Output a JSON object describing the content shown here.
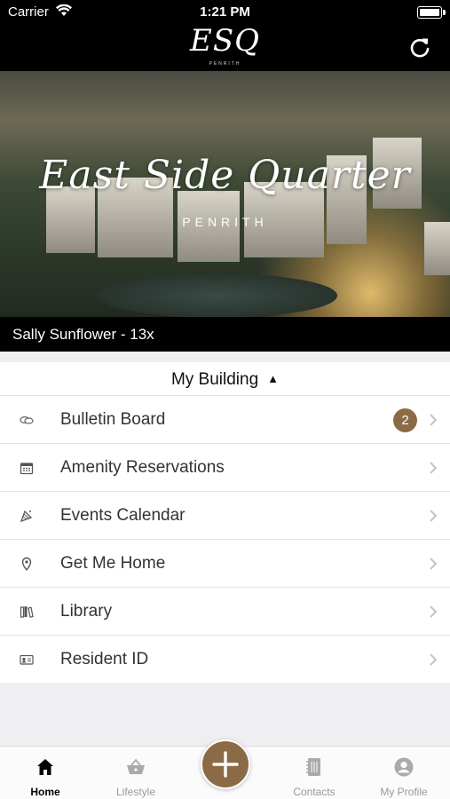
{
  "status_bar": {
    "carrier": "Carrier",
    "time": "1:21 PM"
  },
  "header": {
    "logo": "ESQ",
    "logo_sub": "PENRITH"
  },
  "hero": {
    "title": "East Side Quarter",
    "subtitle": "PENRITH"
  },
  "user": {
    "name": "Sally Sunflower - 13x"
  },
  "section": {
    "title": "My Building",
    "caret": "▲"
  },
  "menu": [
    {
      "label": "Bulletin Board",
      "icon": "chat-bubbles-icon",
      "badge": "2"
    },
    {
      "label": "Amenity Reservations",
      "icon": "calendar-icon"
    },
    {
      "label": "Events Calendar",
      "icon": "party-icon"
    },
    {
      "label": "Get Me Home",
      "icon": "location-pin-icon"
    },
    {
      "label": "Library",
      "icon": "books-icon"
    },
    {
      "label": "Resident ID",
      "icon": "id-card-icon"
    }
  ],
  "tabs": [
    {
      "label": "Home",
      "icon": "house-icon",
      "active": true
    },
    {
      "label": "Lifestyle",
      "icon": "basket-icon"
    },
    {
      "label": "Contacts",
      "icon": "address-book-icon"
    },
    {
      "label": "My Profile",
      "icon": "person-icon"
    }
  ],
  "colors": {
    "accent": "#8b6b46",
    "bar": "#000000",
    "background": "#efeff1"
  }
}
